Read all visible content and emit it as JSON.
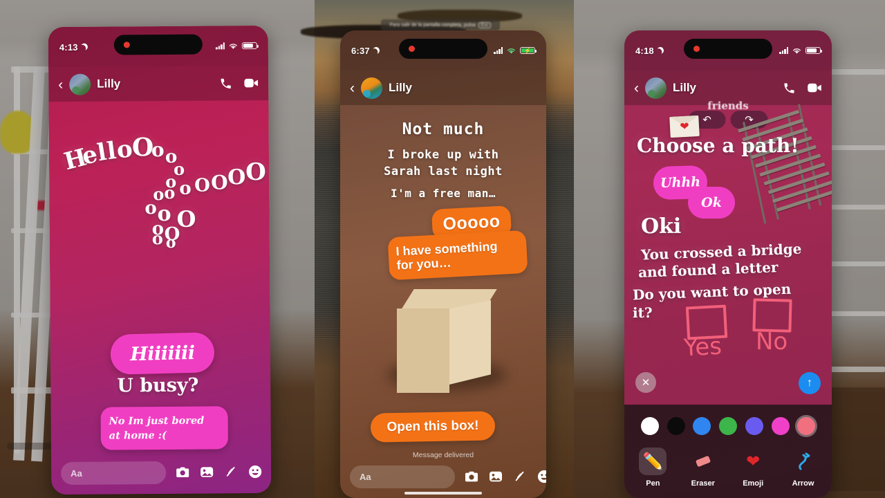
{
  "environment": {
    "description": "Three smartphone screenshots composited over a blurred room with white shelving and a beach sunset photo"
  },
  "fullscreen_hint": {
    "text": "Para salir de la pantalla completa, pulsa",
    "key": "Esc"
  },
  "colors": {
    "pink_bubble": "#f03ec2",
    "orange_bubble": "#f47216",
    "send_blue": "#1b8df0",
    "draw_salmon": "#f2607a"
  },
  "phone1": {
    "status": {
      "time": "4:13",
      "moon_icon": "crescent-moon-icon",
      "recording_icon": "record-dot-icon"
    },
    "header": {
      "back_icon": "chevron-left-icon",
      "contact": "Lilly",
      "call_icon": "phone-icon",
      "video_icon": "video-camera-icon"
    },
    "story": {
      "hello_text": "HelloOoooOoooooOOOoooOOoooOo",
      "hello_letters": [
        "H",
        "e",
        "l",
        "l",
        "o",
        "O",
        "o",
        "o",
        "o",
        "O",
        "o",
        "o",
        "o",
        "o",
        "o",
        "o",
        "O",
        "O",
        "O",
        "o",
        "o",
        "o",
        "O",
        "O",
        "o",
        "o",
        "o",
        "O",
        "o"
      ],
      "hi_bubble": "Hiiiiiii",
      "u_busy": "U busy?",
      "reply_line1": "No Im just bored",
      "reply_line2": "at home :("
    },
    "composer": {
      "placeholder": "Aa",
      "icons": [
        "camera-icon",
        "gallery-icon",
        "doodle-icon",
        "sticker-icon"
      ]
    }
  },
  "phone2": {
    "status": {
      "time": "6:37",
      "moon_icon": "crescent-moon-icon",
      "recording_icon": "record-dot-icon",
      "battery_state": "charging"
    },
    "header": {
      "back_icon": "chevron-left-icon",
      "contact": "Lilly",
      "call_icon": "phone-icon",
      "video_icon": "video-camera-icon"
    },
    "story": {
      "heading": "Not much",
      "line1": "I broke up with",
      "line2": "Sarah last night",
      "line3": "I'm a free man…",
      "bubble1": "Ooooo",
      "bubble2_line1": "I have something",
      "bubble2_line2": "for you…",
      "box_label": "cardboard-box-image",
      "cta": "Open this box!",
      "status_text": "Message delivered"
    },
    "composer": {
      "placeholder": "Aa",
      "icons": [
        "camera-icon",
        "gallery-icon",
        "doodle-icon",
        "sticker-icon"
      ]
    }
  },
  "phone3": {
    "status": {
      "time": "4:18",
      "moon_icon": "crescent-moon-icon",
      "recording_icon": "record-dot-icon"
    },
    "header": {
      "back_icon": "chevron-left-icon",
      "contact": "Lilly",
      "call_icon": "phone-icon",
      "video_icon": "video-camera-icon"
    },
    "overlay": {
      "friends_label": "friends",
      "undo_icon": "undo-arrow-icon",
      "redo_icon": "redo-arrow-icon"
    },
    "story": {
      "heading": "Choose a path!",
      "bubble_uhhh": "Uhhh",
      "bubble_ok": "Ok",
      "oki": "Oki",
      "line1": "You crossed a bridge",
      "line2": "and found a letter",
      "line3": "Do you want to open",
      "line4": "it?",
      "yes_label": "Yes",
      "no_label": "No",
      "letter_icon": "envelope-with-heart-icon",
      "bridge_label": "rope-bridge-image"
    },
    "actions": {
      "close_icon": "close-x-icon",
      "send_icon": "send-up-arrow-icon"
    },
    "palette": {
      "swatches": [
        {
          "name": "white",
          "hex": "#ffffff",
          "selected": false
        },
        {
          "name": "black",
          "hex": "#0c0b0c",
          "selected": false
        },
        {
          "name": "blue",
          "hex": "#2f86f0",
          "selected": false
        },
        {
          "name": "green",
          "hex": "#3cb54a",
          "selected": false
        },
        {
          "name": "purple",
          "hex": "#6a5bf0",
          "selected": false
        },
        {
          "name": "magenta",
          "hex": "#f040c8",
          "selected": false
        },
        {
          "name": "salmon",
          "hex": "#f07080",
          "selected": true
        }
      ],
      "tools": [
        {
          "label": "Pen",
          "icon": "pencil-icon",
          "active": true
        },
        {
          "label": "Eraser",
          "icon": "eraser-icon",
          "active": false
        },
        {
          "label": "Emoji",
          "icon": "heart-icon",
          "active": false
        },
        {
          "label": "Arrow",
          "icon": "arrow-icon",
          "active": false
        }
      ]
    }
  }
}
